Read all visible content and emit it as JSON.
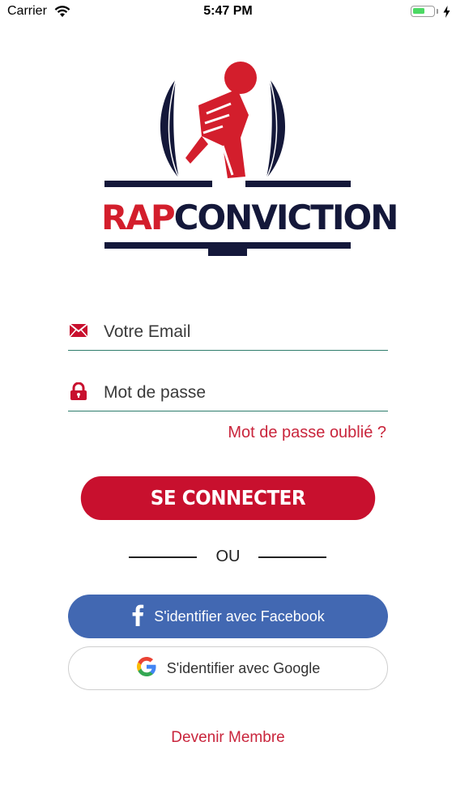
{
  "status_bar": {
    "carrier": "Carrier",
    "time": "5:47 PM",
    "battery_level": 0.6
  },
  "logo": {
    "part1": "RAP",
    "part2": "CONVICTION"
  },
  "form": {
    "email_placeholder": "Votre Email",
    "password_placeholder": "Mot de passe",
    "forgot_label": "Mot de passe oublié ?",
    "connect_label": "SE CONNECTER",
    "divider_label": "OU"
  },
  "social": {
    "facebook_label": "S'identifier avec Facebook",
    "google_label": "S'identifier avec Google"
  },
  "footer": {
    "member_label": "Devenir Membre"
  },
  "colors": {
    "accent": "#c8102e",
    "navy": "#14183a",
    "facebook": "#4268b2",
    "field_underline": "#2e7d6c"
  }
}
